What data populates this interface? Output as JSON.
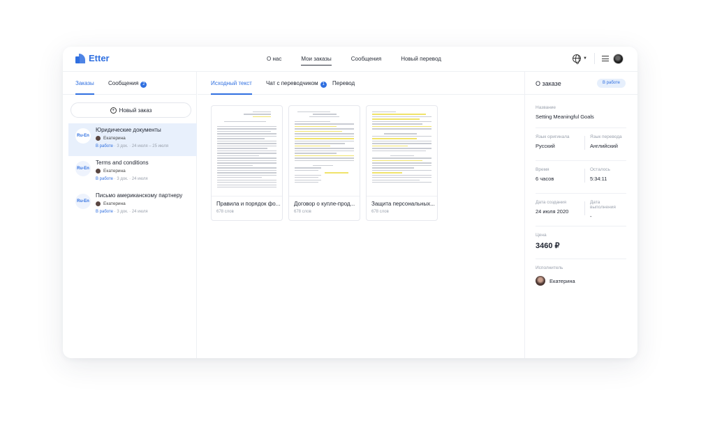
{
  "brand": {
    "name": "Etter",
    "color": "#2f6fe0"
  },
  "nav": [
    "О нас",
    "Мои заказы",
    "Сообщения",
    "Новый перевод"
  ],
  "header_icons": [
    "globe-icon",
    "chevron-down-icon",
    "menu-icon",
    "avatar"
  ],
  "left": {
    "tabs": {
      "orders": "Заказы",
      "messages": "Сообщения",
      "messages_count": "2"
    },
    "new_order": "Новый заказ",
    "orders": [
      {
        "pair": "Ru-En",
        "title": "Юридические документы",
        "user": "Екатерина",
        "status": "В работе",
        "meta": " · 3 док. · 24 июля – 25 июля"
      },
      {
        "pair": "Ru-En",
        "title": "Terms and conditions",
        "user": "Екатерина",
        "status": "В работе",
        "meta": " · 3 док. · 24 июля"
      },
      {
        "pair": "Ru-En",
        "title": "Письмо американскому партнеру",
        "user": "Екатерина",
        "status": "В работе",
        "meta": " · 3 док. · 24 июля"
      }
    ]
  },
  "middle": {
    "tabs": {
      "source": "Исходный текст",
      "chat": "Чат с переводчиком",
      "chat_count": "1",
      "translation": "Перевод"
    },
    "docs": [
      {
        "name": "Правила и порядок фо...",
        "words": "678 слов"
      },
      {
        "name": "Договор о купле-прод...",
        "words": "678 слов"
      },
      {
        "name": "Защита персональных...",
        "words": "678 слов"
      }
    ]
  },
  "order": {
    "title": "О заказе",
    "status": "В работе",
    "name_label": "Название",
    "name": "Setting Meaningful Goals",
    "src_lang_label": "Язык оригинала",
    "src_lang": "Русский",
    "tgt_lang_label": "Язык перевода",
    "tgt_lang": "Английский",
    "time_label": "Время",
    "time": "6 часов",
    "left_label": "Осталось",
    "left": "5:34:11",
    "created_label": "Дата создания",
    "created": "24 июля 2020",
    "done_label": "Дата выполнения",
    "done": "-",
    "price_label": "Цена",
    "price": "3460 ₽",
    "performer_label": "Исполнитель",
    "performer": "Екатерина"
  }
}
